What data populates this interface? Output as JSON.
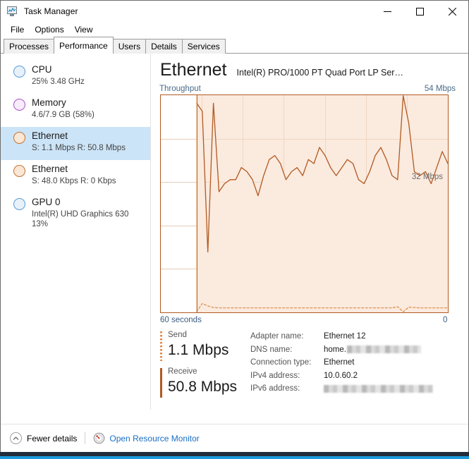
{
  "window": {
    "title": "Task Manager",
    "icon": "task-manager-icon",
    "controls": {
      "minimize": "—",
      "maximize": "□",
      "close": "✕"
    }
  },
  "menu": {
    "items": [
      "File",
      "Options",
      "View"
    ]
  },
  "tabs": {
    "items": [
      "Processes",
      "Performance",
      "Users",
      "Details",
      "Services"
    ],
    "active": "Performance"
  },
  "sidebar": {
    "items": [
      {
        "title": "CPU",
        "sub": "25%  3.48 GHz",
        "sub2": "",
        "color": "#5b9bd5",
        "selected": false
      },
      {
        "title": "Memory",
        "sub": "4.6/7.9 GB (58%)",
        "sub2": "",
        "color": "#a855c8",
        "selected": false
      },
      {
        "title": "Ethernet",
        "sub": "S: 1.1 Mbps R: 50.8 Mbps",
        "sub2": "",
        "color": "#d98c46",
        "selected": true
      },
      {
        "title": "Ethernet",
        "sub": "S: 48.0 Kbps R: 0 Kbps",
        "sub2": "",
        "color": "#d98c46",
        "selected": false
      },
      {
        "title": "GPU 0",
        "sub": "Intel(R) UHD Graphics 630",
        "sub2": "13%",
        "color": "#5b9bd5",
        "selected": false
      }
    ]
  },
  "main": {
    "title": "Ethernet",
    "adapter_description": "Intel(R) PRO/1000 PT Quad Port LP Ser…",
    "graph_caption": "Throughput",
    "graph_max": "54 Mbps",
    "graph_inner_label": "32 Mbps",
    "axis_left": "60 seconds",
    "axis_right": "0",
    "accent_color": "#b05a22",
    "fill_color": "#fbeade"
  },
  "stats": {
    "send": {
      "label": "Send",
      "value": "1.1 Mbps",
      "marker": "dotted"
    },
    "receive": {
      "label": "Receive",
      "value": "50.8 Mbps",
      "marker": "solid"
    }
  },
  "info": {
    "rows": [
      {
        "label": "Adapter name:",
        "value": "Ethernet 12",
        "redacted": false,
        "prefix": ""
      },
      {
        "label": "DNS name:",
        "value": "",
        "redacted": true,
        "prefix": "home.",
        "redact_width": 105
      },
      {
        "label": "Connection type:",
        "value": "Ethernet",
        "redacted": false,
        "prefix": ""
      },
      {
        "label": "IPv4 address:",
        "value": "10.0.60.2",
        "redacted": false,
        "prefix": ""
      },
      {
        "label": "IPv6 address:",
        "value": "",
        "redacted": true,
        "prefix": "",
        "redact_width": 155
      }
    ]
  },
  "footer": {
    "fewer_details": "Fewer details",
    "open_resource_monitor": "Open Resource Monitor",
    "link_color": "#1a6fc4"
  },
  "chart_data": {
    "type": "area",
    "title": "Throughput",
    "ylabel": "Mbps",
    "xlabel": "seconds",
    "ylim": [
      0,
      54
    ],
    "xlim": [
      60,
      0
    ],
    "grid": true,
    "gridlines_y": 4,
    "gridlines_x": 6,
    "inner_annotation": "32 Mbps",
    "axis_tick_labels": {
      "left": "60 seconds",
      "right": "0"
    },
    "series": [
      {
        "name": "Receive",
        "style": "solid",
        "color": "#b05a22",
        "filled": true,
        "x_start_pct": 12.5,
        "values": [
          52,
          50,
          15,
          52,
          30,
          32,
          33,
          33,
          36,
          35,
          33,
          29,
          34,
          38,
          39,
          37,
          33,
          35,
          36,
          34,
          38,
          37,
          41,
          39,
          36,
          34,
          36,
          38,
          37,
          33,
          32,
          35,
          39,
          41,
          38,
          34,
          33,
          54,
          47,
          35,
          34,
          35,
          32,
          36,
          40,
          37
        ]
      },
      {
        "name": "Send",
        "style": "dashed",
        "color": "#d98c46",
        "filled": false,
        "x_start_pct": 12.5,
        "values": [
          0.2,
          2.2,
          1.6,
          1.2,
          1.1,
          1.1,
          1.1,
          1.1,
          1.1,
          1.1,
          1.1,
          1.1,
          1.1,
          1.1,
          1.1,
          1.1,
          1.1,
          1.1,
          1.1,
          1.1,
          1.1,
          1.1,
          1.1,
          1.1,
          1.1,
          1.1,
          1.1,
          1.1,
          1.1,
          1.1,
          1.1,
          1.1,
          1.1,
          1.1,
          1.1,
          1.1,
          1.4,
          0.1,
          1.3,
          1.2,
          1.1,
          1.1,
          1.1,
          1.1,
          1.1,
          1.1
        ]
      }
    ]
  }
}
